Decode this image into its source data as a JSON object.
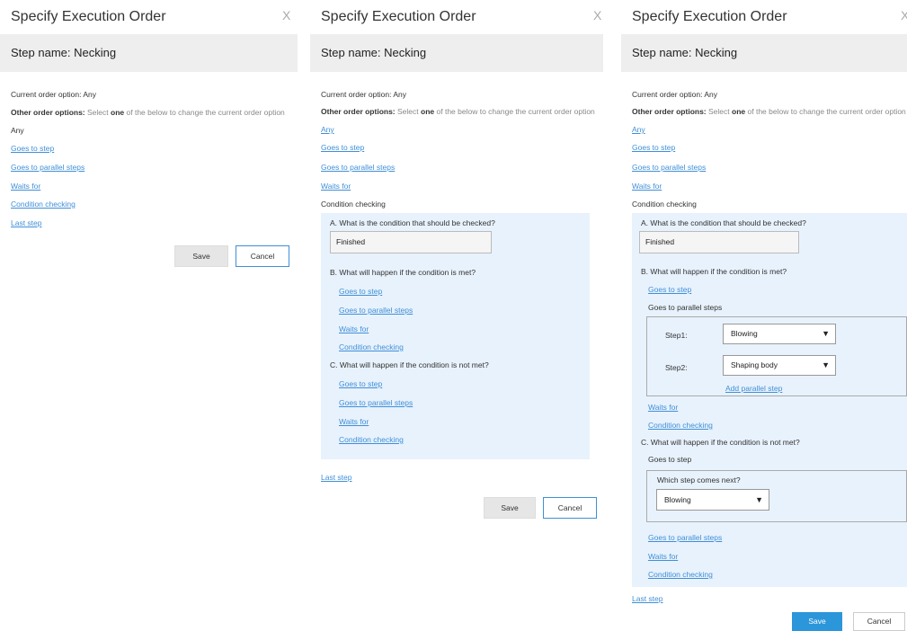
{
  "dialog": {
    "title": "Specify Execution Order",
    "close_icon": "X",
    "step_name": "Step name: Necking",
    "current_order": "Current order option: Any",
    "other_label": "Other order options:",
    "other_text_pre": "Select",
    "other_text_bold": "one",
    "other_text_post": "of the below to change the current order option",
    "save_label": "Save",
    "cancel_label": "Cancel"
  },
  "options": {
    "any": "Any",
    "goes_to_step": "Goes to step",
    "goes_to_parallel": "Goes to parallel steps",
    "waits_for": "Waits for",
    "condition_checking": "Condition checking",
    "last_step": "Last step"
  },
  "condition": {
    "question_a": "A. What is the condition that should be checked?",
    "condition_value": "Finished",
    "question_b": "B. What will happen if the condition is met?",
    "question_c": "C. What will happen if the condition is not met?"
  },
  "parallel": {
    "heading": "Goes to parallel steps",
    "step1_label": "Step1:",
    "step1_value": "Blowing",
    "step2_label": "Step2:",
    "step2_value": "Shaping body",
    "add_link": "Add parallel step",
    "arrow": "▼"
  },
  "goes_to_step_block": {
    "heading": "Goes to step",
    "question": "Which step comes next?",
    "value": "Blowing"
  },
  "colors": {
    "link": "#3f8fd8",
    "primary": "#2b96d9",
    "panel_bg": "#e8f2fc"
  }
}
